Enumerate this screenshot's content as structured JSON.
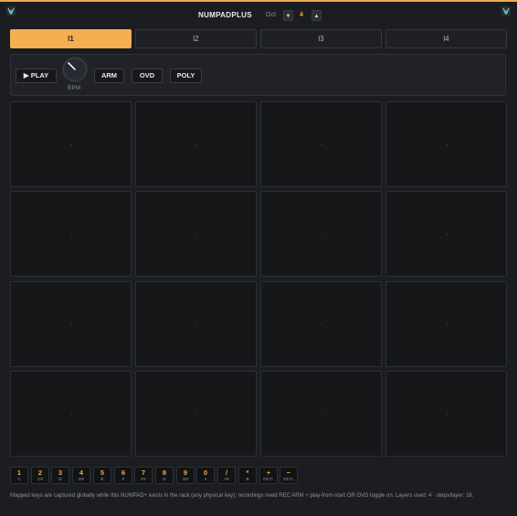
{
  "header": {
    "title": "NUMPADPLUS",
    "oct_label": "Oct",
    "oct_value": "4",
    "oct_down_glyph": "▼",
    "oct_up_glyph": "▲"
  },
  "tabs": [
    {
      "label": "l1",
      "active": true
    },
    {
      "label": "l2",
      "active": false
    },
    {
      "label": "l3",
      "active": false
    },
    {
      "label": "l4",
      "active": false
    }
  ],
  "controls": {
    "play_label": "▶ PLAY",
    "arm_label": "ARM",
    "ovd_label": "OVD",
    "poly_label": "POLY",
    "bpm_label": "BPM"
  },
  "pads": [
    ".",
    ".",
    ".",
    ".",
    ".",
    ".",
    ".",
    ".",
    ".",
    ".",
    ".",
    ".",
    ".",
    ".",
    ".",
    "."
  ],
  "keys": [
    {
      "key": "1",
      "note": "C"
    },
    {
      "key": "2",
      "note": "C#"
    },
    {
      "key": "3",
      "note": "D"
    },
    {
      "key": "4",
      "note": "D#"
    },
    {
      "key": "5",
      "note": "E"
    },
    {
      "key": "6",
      "note": "F"
    },
    {
      "key": "7",
      "note": "F#"
    },
    {
      "key": "8",
      "note": "G"
    },
    {
      "key": "9",
      "note": "G#"
    },
    {
      "key": "0",
      "note": "A"
    },
    {
      "key": "/",
      "note": "A#"
    },
    {
      "key": "*",
      "note": "B"
    },
    {
      "key": "+",
      "note": "OCT↑"
    },
    {
      "key": "−",
      "note": "OCT↓"
    }
  ],
  "footer": {
    "text": "Mapped keys are captured globally while this NUMPAD+ exists in the rack (any physical key); recordings need REC ARM + play-from-start OR OVD toggle on. Layers used: 4 · steps/layer: 16."
  },
  "colors": {
    "accent": "#f0a947",
    "background": "#1b1d21",
    "pad": "#151719",
    "screw": "#6fc3c9"
  }
}
